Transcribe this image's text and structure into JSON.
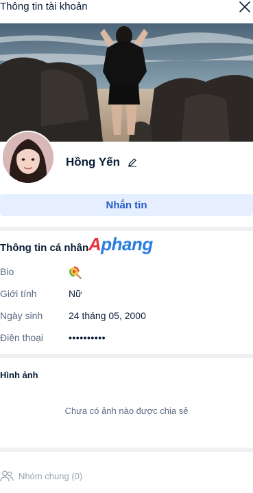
{
  "header": {
    "title": "Thông tin tài khoản",
    "close_icon": "close-icon"
  },
  "profile": {
    "name": "Hồng Yến",
    "edit_icon": "pencil-icon",
    "message_label": "Nhắn tin"
  },
  "personal_info": {
    "title": "Thông tin cá nhân",
    "watermark": "Aphang",
    "rows": [
      {
        "label": "Bio",
        "value": "",
        "icon": "lollipop-icon"
      },
      {
        "label": "Giới tính",
        "value": "Nữ"
      },
      {
        "label": "Ngày sinh",
        "value": "24 tháng 05, 2000"
      },
      {
        "label": "Điện thoại",
        "value": "••••••••••"
      }
    ]
  },
  "photos": {
    "title": "Hình ảnh",
    "empty_text": "Chưa có ảnh nào được chia sẻ"
  },
  "groups": {
    "label": "Nhóm chung (0)",
    "icon": "users-icon"
  },
  "colors": {
    "accent": "#2459c8",
    "button_bg": "#e5efff",
    "divider": "#eef0f1",
    "text_primary": "#081c36",
    "text_secondary": "#5a6981"
  }
}
